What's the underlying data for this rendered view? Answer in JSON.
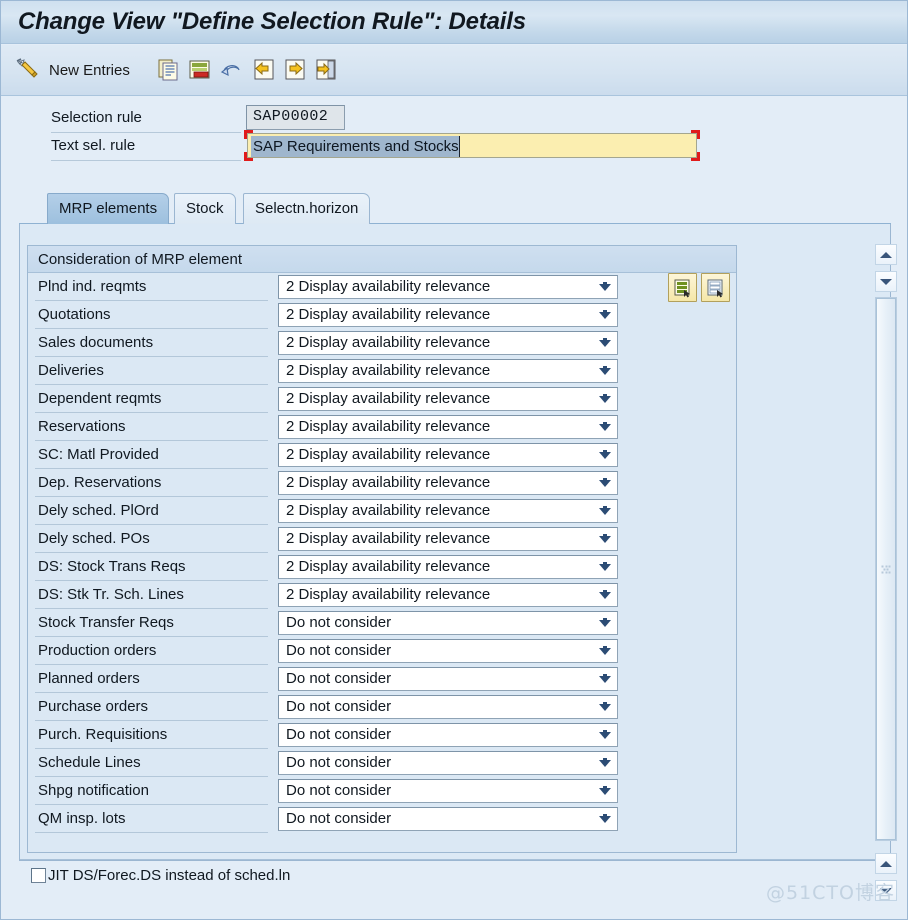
{
  "window": {
    "title": "Change View \"Define Selection Rule\": Details"
  },
  "toolbar": {
    "edit_icon": "pencil-edit-icon",
    "new_entries_label": "New Entries",
    "buttons": [
      {
        "icon": "copy-icon",
        "name": "copy-button"
      },
      {
        "icon": "delete-row-icon",
        "name": "delete-button"
      },
      {
        "icon": "undo-icon",
        "name": "undo-button"
      },
      {
        "icon": "previous-entry-icon",
        "name": "previous-entry-button"
      },
      {
        "icon": "next-entry-icon",
        "name": "next-entry-button"
      },
      {
        "icon": "goto-entry-icon",
        "name": "goto-entry-button"
      }
    ]
  },
  "form": {
    "selection_rule": {
      "label": "Selection rule",
      "value": "SAP00002"
    },
    "text_sel_rule": {
      "label": "Text sel. rule",
      "value": "SAP Requirements and Stocks",
      "placeholder": ""
    }
  },
  "tabs": [
    {
      "label": "MRP elements",
      "name": "tab-mrp-elements",
      "active": true
    },
    {
      "label": "Stock",
      "name": "tab-stock",
      "active": false
    },
    {
      "label": "Selectn.horizon",
      "name": "tab-selectn-horizon",
      "active": false
    }
  ],
  "group": {
    "header": "Consideration of MRP element",
    "row_actions": [
      {
        "icon": "select-all-icon",
        "name": "select-all-button"
      },
      {
        "icon": "deselect-all-icon",
        "name": "deselect-all-button"
      }
    ],
    "rows": [
      {
        "label": "Plnd ind. reqmts",
        "value": "2 Display availability relevance"
      },
      {
        "label": "Quotations",
        "value": "2 Display availability relevance"
      },
      {
        "label": "Sales documents",
        "value": "2 Display availability relevance"
      },
      {
        "label": "Deliveries",
        "value": "2 Display availability relevance"
      },
      {
        "label": "Dependent reqmts",
        "value": "2 Display availability relevance"
      },
      {
        "label": "Reservations",
        "value": "2 Display availability relevance"
      },
      {
        "label": "SC: Matl Provided",
        "value": "2 Display availability relevance"
      },
      {
        "label": "Dep. Reservations",
        "value": "2 Display availability relevance"
      },
      {
        "label": "Dely sched. PlOrd",
        "value": "2 Display availability relevance"
      },
      {
        "label": "Dely sched. POs",
        "value": "2 Display availability relevance"
      },
      {
        "label": "DS: Stock Trans Reqs",
        "value": "2 Display availability relevance"
      },
      {
        "label": "DS: Stk Tr. Sch. Lines",
        "value": "2 Display availability relevance"
      },
      {
        "label": "Stock Transfer Reqs",
        "value": "Do not consider"
      },
      {
        "label": "Production orders",
        "value": "Do not consider"
      },
      {
        "label": "Planned orders",
        "value": "Do not consider"
      },
      {
        "label": "Purchase orders",
        "value": "Do not consider"
      },
      {
        "label": "Purch. Requisitions",
        "value": "Do not consider"
      },
      {
        "label": "Schedule Lines",
        "value": "Do not consider"
      },
      {
        "label": "Shpg notification",
        "value": "Do not consider"
      },
      {
        "label": "QM insp. lots",
        "value": "Do not consider"
      }
    ]
  },
  "checkbox": {
    "label": "JIT DS/Forec.DS instead of sched.ln",
    "checked": false
  },
  "watermark": "@51CTO博客",
  "colors": {
    "title_bar": "#cfe0ef",
    "panel_bg": "#dce9f5",
    "active_tab": "#a7c8e3",
    "focus_marker": "#e01b1b",
    "input_focus_bg": "#fbeeb0",
    "selection_highlight": "#9fb6cd",
    "dropdown_arrow": "#2c4c74"
  }
}
